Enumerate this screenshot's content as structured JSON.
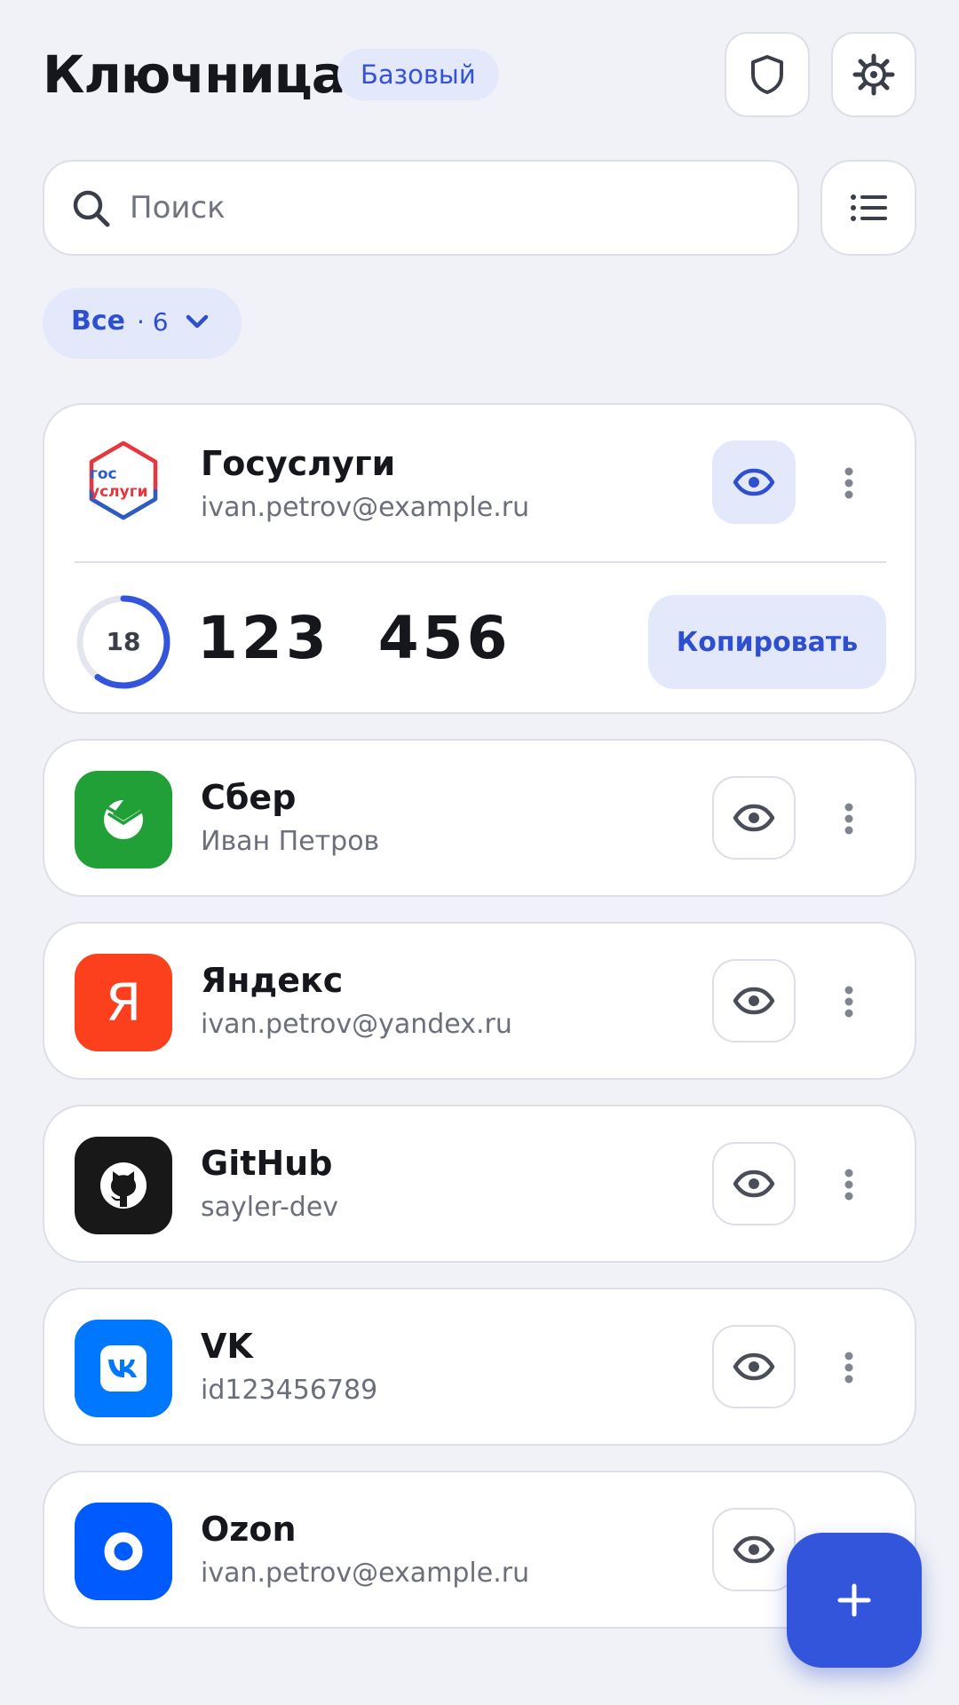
{
  "header": {
    "title": "Ключница",
    "plan_badge": "Базовый",
    "security_icon": "shield-icon",
    "settings_icon": "gear-icon"
  },
  "search": {
    "placeholder": "Поиск",
    "value": ""
  },
  "view_toggle_icon": "list-icon",
  "filter": {
    "label": "Все",
    "count": "· 6"
  },
  "accounts": [
    {
      "name": "Госуслуги",
      "login": "ivan.petrov@example.ru",
      "logo_text_top": "гос",
      "logo_text_bottom": "услуги",
      "expanded": true,
      "otp": {
        "code": "123  456",
        "seconds_left": "18",
        "progress": 0.6,
        "copy_label": "Копировать"
      }
    },
    {
      "name": "Сбер",
      "login": "Иван Петров",
      "logo_color": "#21a038",
      "logo_icon": "sber-icon"
    },
    {
      "name": "Яндекс",
      "login": "ivan.petrov@yandex.ru",
      "logo_color": "#fc3f1d",
      "logo_text": "Я"
    },
    {
      "name": "GitHub",
      "login": "sayler-dev",
      "logo_color": "#181818",
      "logo_icon": "github-icon"
    },
    {
      "name": "VK",
      "login": "id123456789",
      "logo_color": "#0077ff",
      "logo_icon": "vk-icon"
    },
    {
      "name": "Ozon",
      "login": "ivan.petrov@example.ru",
      "logo_color": "#005bff",
      "logo_icon": "ozon-icon"
    }
  ],
  "fab": {
    "icon": "plus-icon"
  },
  "colors": {
    "accent": "#3355dc",
    "accent_light": "#e3e9fb",
    "background": "#f0f2f7"
  }
}
